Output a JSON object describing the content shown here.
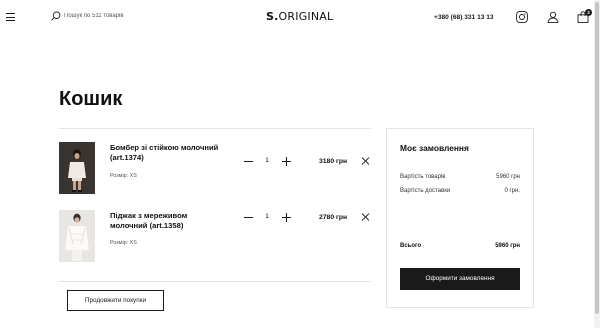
{
  "header": {
    "menu_icon": "hamburger-menu-icon",
    "search_icon": "search-icon",
    "search_placeholder": "Пошук по 511 товарів",
    "logo_bold": "S.",
    "logo_rest": "ORIGINAL",
    "phone": "+380 (68) 331 13 13",
    "instagram_icon": "instagram-icon",
    "account_icon": "user-icon",
    "cart_icon": "shopping-bag-icon",
    "cart_count": "2"
  },
  "page": {
    "title": "Кошик"
  },
  "cart": {
    "items": [
      {
        "name": "Бомбер зі стійкою молочний (art.1374)",
        "size": "Розмір: XS",
        "quantity": "1",
        "price": "3180 грн",
        "image": "product-photo-bomber"
      },
      {
        "name": "Піджак з мереживом молочний (art.1358)",
        "size": "Розмір: XS",
        "quantity": "1",
        "price": "2780 грн",
        "image": "product-photo-jacket"
      }
    ],
    "continue_label": "Продовжити покупки"
  },
  "summary": {
    "title": "Моє замовлення",
    "goods_label": "Вартість товарів",
    "goods_value": "5960 грн",
    "delivery_label": "Вартість доставки",
    "delivery_value": "0 грн.",
    "total_label": "Всього",
    "total_value": "5960 грн",
    "checkout_label": "Оформити замовлення"
  },
  "colors": {
    "accent": "#1a1a1a",
    "divider": "#e4e4e4",
    "background": "#ffffff"
  }
}
